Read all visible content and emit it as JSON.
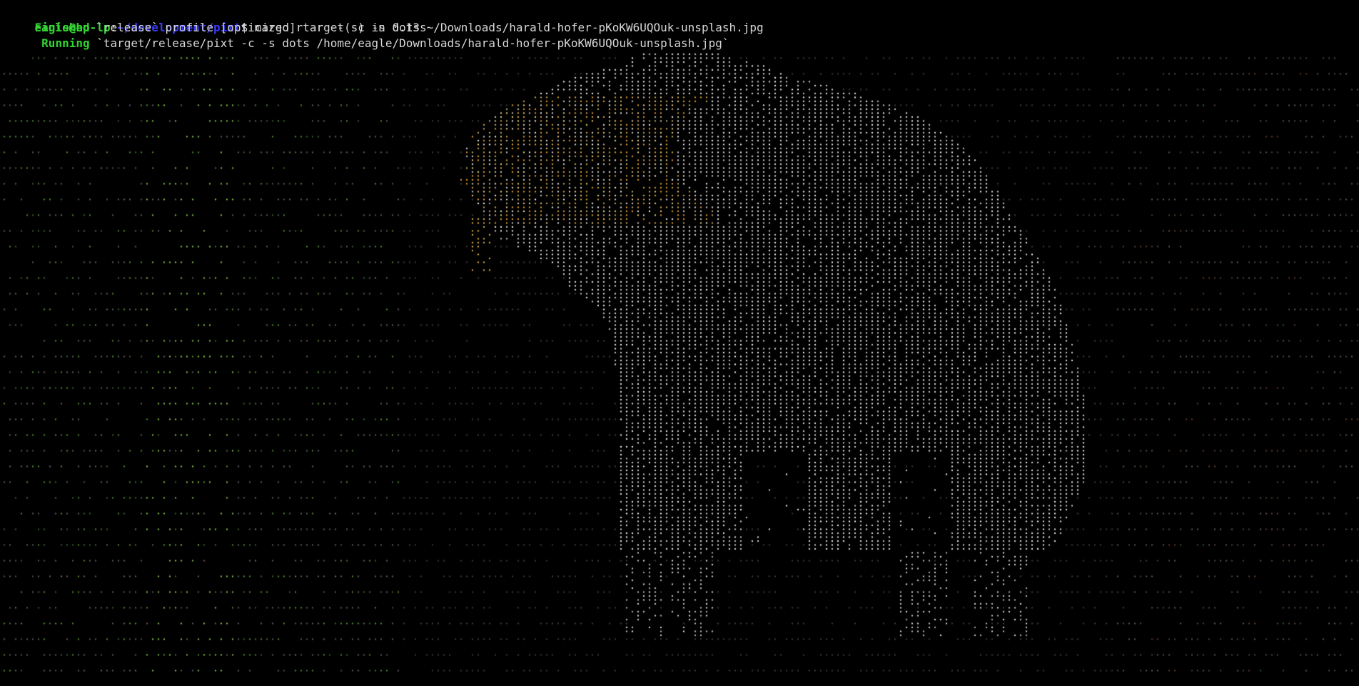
{
  "terminal": {
    "prompt": {
      "user_host": "eagle@hp-lp",
      "separator": ":",
      "cwd": "~/development/pixt",
      "symbol": "$",
      "command": " cargo r -r -- -c -s dots ~/Downloads/harald-hofer-pKoKW6UQOuk-unsplash.jpg"
    },
    "output": [
      {
        "indent": "    ",
        "status": "Finished",
        "message": " `release` profile [optimized] target(s) in 0.13s"
      },
      {
        "indent": "     ",
        "status": "Running",
        "message": " `target/release/pixt -c -s dots /home/eagle/Downloads/harald-hofer-pKoKW6UQOuk-unsplash.jpg`"
      }
    ]
  },
  "art": {
    "style": "dots",
    "colors": {
      "background": "#000000",
      "horse": "#e6e6e6",
      "mane": "#e0a020",
      "grass": "#7fbf3f",
      "dark": "#3c4a3c"
    }
  }
}
